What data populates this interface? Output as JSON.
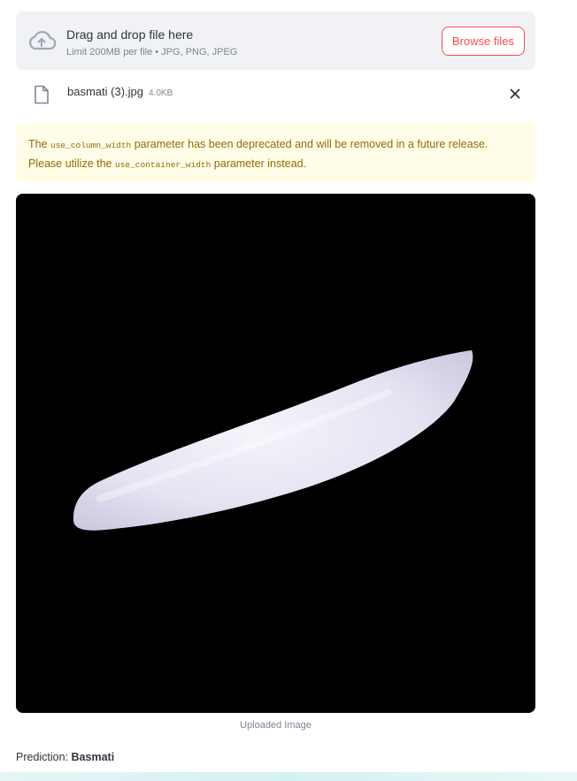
{
  "uploader": {
    "title": "Drag and drop file here",
    "subtitle": "Limit 200MB per file • JPG, PNG, JPEG",
    "browse_label": "Browse files",
    "icon": "cloud-upload-icon"
  },
  "file": {
    "name": "basmati (3).jpg",
    "size": "4.0KB",
    "icon": "file-icon",
    "remove_icon": "close-icon"
  },
  "warning": {
    "text_1": "The ",
    "code_1": "use_column_width",
    "text_2": " parameter has been deprecated and will be removed in a future release. Please utilize the ",
    "code_2": "use_container_width",
    "text_3": " parameter instead."
  },
  "image": {
    "caption": "Uploaded Image"
  },
  "prediction": {
    "label": "Prediction: ",
    "value": "Basmati"
  },
  "colors": {
    "accent": "#ff4b4b",
    "dropzone_bg": "#f0f2f6",
    "warning_bg": "#fffce7",
    "warning_text": "#926c05"
  }
}
